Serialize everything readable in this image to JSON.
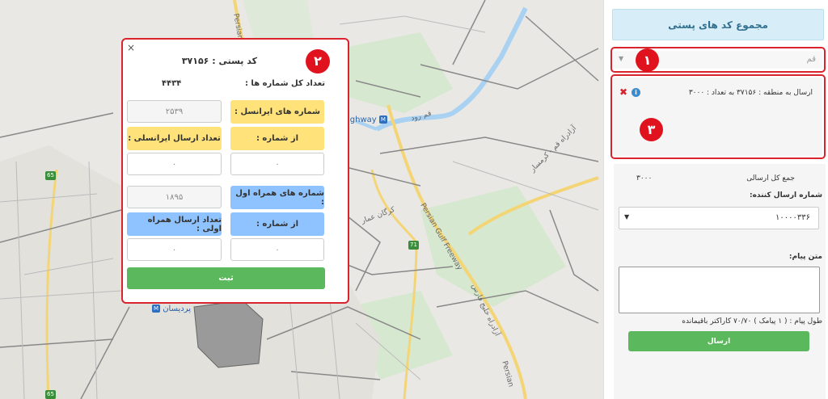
{
  "map": {
    "labels": {
      "highway": "ighway",
      "road_vertical": "Persian G",
      "freeway_diag": "Persian Gulf Freeway",
      "road_fa_1": "قم رود",
      "road_fa_2": "آزادراه قم - کرمسار",
      "road_fa_3": "آزادراه خلیج فارس",
      "road_fa_4": "کرگان عمار",
      "station": "پردیسان",
      "persian_bottom": "Persian"
    },
    "shields": [
      "65",
      "71",
      "65"
    ]
  },
  "popup": {
    "close_glyph": "×",
    "badge": "۲",
    "title": "کد پستی : ۳۷۱۵۶",
    "total_label": "تعداد کل شماره ها :",
    "total_value": "۴۴۳۴",
    "irancell_label": "شماره های ایرانسل :",
    "irancell_value": "۲۵۳۹",
    "irancell_from_label": "از شماره :",
    "irancell_send_label": "تعداد ارسال ایرانسلی :",
    "irancell_from_value": "۰",
    "irancell_send_value": "۰",
    "mci_label": "شماره های همراه اول :",
    "mci_value": "۱۸۹۵",
    "mci_from_label": "از شماره :",
    "mci_send_label": "تعداد ارسال همراه اولی :",
    "mci_from_value": "۰",
    "mci_send_value": "۰",
    "submit_label": "ثبت"
  },
  "panel": {
    "header": "مجموع کد های پستی",
    "badge_1": "۱",
    "city_select": "قم",
    "info_line": "ارسال به منطقه : ۳۷۱۵۶     به تعداد : ۳۰۰۰",
    "badge_3": "۳",
    "sum_label": "جمع کل ارسالی",
    "sum_value": "۳۰۰۰",
    "sender_label": "شماره ارسال کننده:",
    "sender_value": "۱۰۰۰۰۳۳۶",
    "message_label": "متن پیام:",
    "message_value": "",
    "length_text": "طول پیام : ( ۱ پیامک ) ۷۰/۷۰ کاراکتر باقیمانده",
    "send_label": "ارسال"
  },
  "colors": {
    "accent_red": "#d9232d",
    "green": "#5cb85c",
    "yellow": "#ffe27a",
    "blue": "#8fc3ff",
    "header_blue": "#d7edf8"
  }
}
